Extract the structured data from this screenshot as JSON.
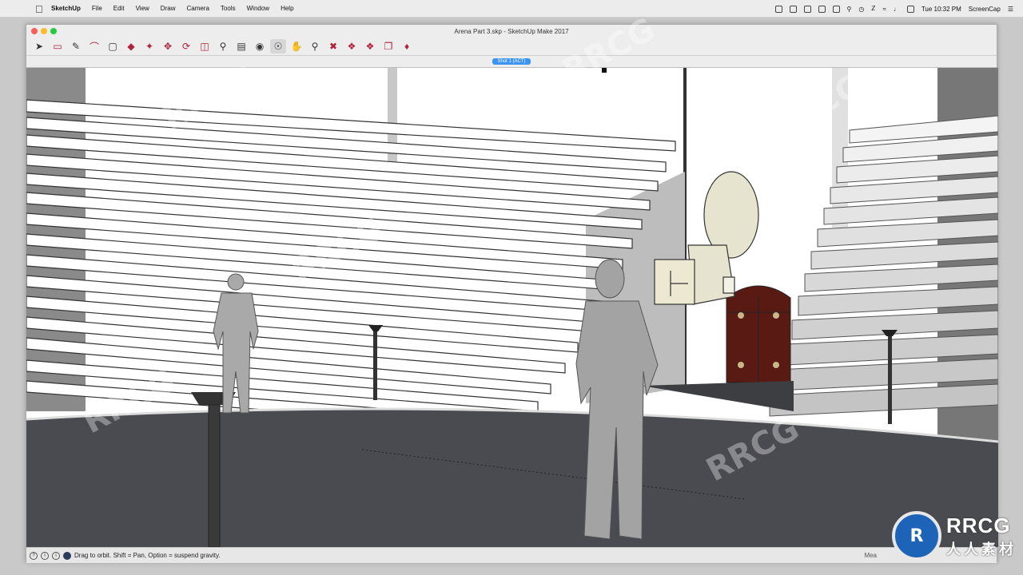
{
  "menubar": {
    "app_name": "SketchUp",
    "menus": [
      "File",
      "Edit",
      "View",
      "Draw",
      "Camera",
      "Tools",
      "Window",
      "Help"
    ],
    "clock": "Tue 10:32 PM",
    "user": "ScreenCap"
  },
  "window": {
    "title": "Arena Part 3.skp - SketchUp Make 2017",
    "scene_tab": "Shot 1 (ACT)"
  },
  "toolbar": {
    "tools": [
      {
        "icon": "select-arrow-icon"
      },
      {
        "icon": "eraser-icon"
      },
      {
        "icon": "pencil-line-icon"
      },
      {
        "icon": "arc-icon"
      },
      {
        "icon": "shape-rectangle-icon"
      },
      {
        "icon": "push-pull-icon"
      },
      {
        "icon": "follow-me-icon"
      },
      {
        "icon": "move-icon"
      },
      {
        "icon": "rotate-icon"
      },
      {
        "icon": "scale-icon"
      },
      {
        "icon": "tape-measure-icon"
      },
      {
        "icon": "text-icon"
      },
      {
        "icon": "paint-bucket-icon"
      },
      {
        "icon": "orbit-icon"
      },
      {
        "icon": "pan-icon"
      },
      {
        "icon": "zoom-icon"
      },
      {
        "icon": "zoom-extents-icon"
      },
      {
        "icon": "3d-warehouse-icon"
      },
      {
        "icon": "extension-warehouse-icon"
      },
      {
        "icon": "layout-send-icon"
      },
      {
        "icon": "ruby-icon"
      }
    ]
  },
  "statusbar": {
    "hint": "Drag to orbit. Shift = Pan, Option = suspend gravity.",
    "measure_label": "Mea"
  },
  "watermark": {
    "logo_text": "RRCG",
    "logo_subtext": "人人素材",
    "brand_color": "#1d63b8"
  }
}
